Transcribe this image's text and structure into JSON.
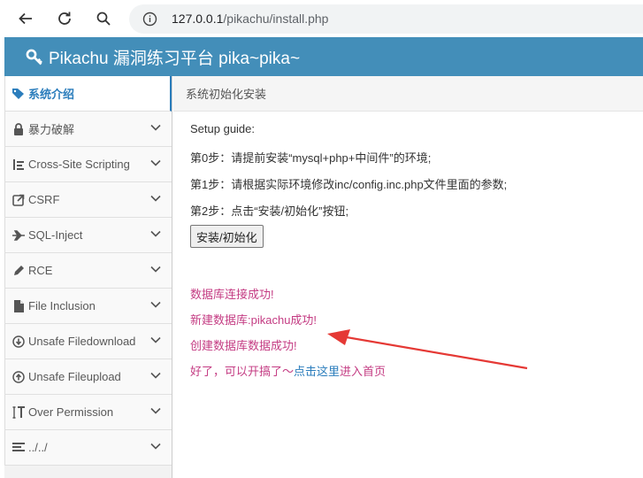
{
  "browser": {
    "url_host": "127.0.0.1",
    "url_path": "/pikachu/install.php"
  },
  "header": {
    "title": "Pikachu 漏洞练习平台 pika~pika~"
  },
  "sidebar": {
    "items": [
      {
        "label": "系统介绍",
        "icon": "tags-icon"
      },
      {
        "label": "暴力破解",
        "icon": "lock-icon"
      },
      {
        "label": "Cross-Site Scripting",
        "icon": "list-icon"
      },
      {
        "label": "CSRF",
        "icon": "share-icon"
      },
      {
        "label": "SQL-Inject",
        "icon": "plane-icon"
      },
      {
        "label": "RCE",
        "icon": "pencil-icon"
      },
      {
        "label": "File Inclusion",
        "icon": "file-icon"
      },
      {
        "label": "Unsafe Filedownload",
        "icon": "download-icon"
      },
      {
        "label": "Unsafe Fileupload",
        "icon": "upload-icon"
      },
      {
        "label": "Over Permission",
        "icon": "text-height-icon"
      },
      {
        "label": "../../",
        "icon": "align-icon"
      }
    ]
  },
  "main": {
    "breadcrumb": "系统初始化安装",
    "guide_title": "Setup guide:",
    "step0": "第0步：请提前安装“mysql+php+中间件”的环境;",
    "step1": "第1步：请根据实际环境修改inc/config.inc.php文件里面的参数;",
    "step2": "第2步：点击“安装/初始化”按钮;",
    "install_button": "安装/初始化",
    "msg_db_connect": "数据库连接成功!",
    "msg_db_create": "新建数据库:pikachu成功!",
    "msg_data_create": "创建数据库数据成功!",
    "msg_done_prefix": "好了，可以开搞了～",
    "msg_done_link": "点击这里",
    "msg_done_suffix": "进入首页"
  },
  "colors": {
    "header_bg": "#438eb9",
    "message": "#c43c83",
    "link": "#2b7dbc",
    "annotation_arrow": "#e53935"
  }
}
